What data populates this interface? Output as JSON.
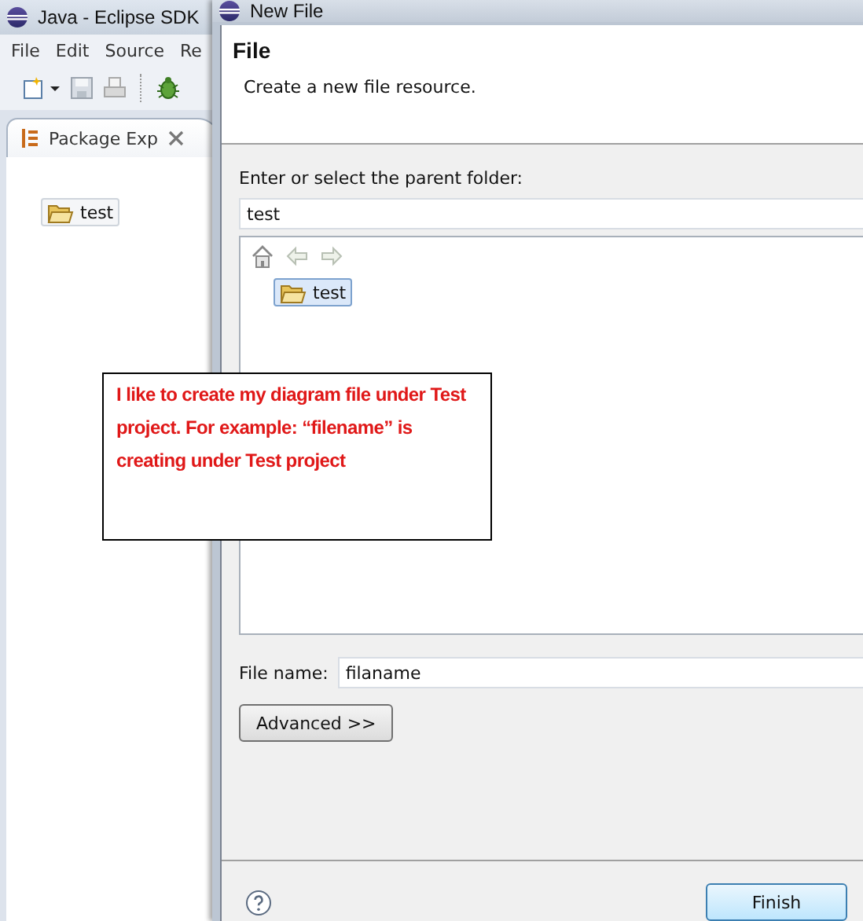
{
  "background_window": {
    "title": "Java - Eclipse SDK",
    "menu": [
      "File",
      "Edit",
      "Source",
      "Re"
    ],
    "view_tab": {
      "label": "Package Exp"
    },
    "tree": [
      {
        "label": "test",
        "selected": true
      }
    ]
  },
  "dialog": {
    "title": "New File",
    "heading": "File",
    "description": "Create a new file resource.",
    "folder_label": "Enter or select the parent folder:",
    "folder_value": "test",
    "folder_tree": [
      {
        "label": "test",
        "selected": true
      }
    ],
    "file_name_label": "File name:",
    "file_name_value": "filaname",
    "advanced_button": "Advanced >>",
    "finish_button": "Finish"
  },
  "callout": {
    "text": "I like to create my diagram file under Test project. For example: “filename” is creating under Test project"
  }
}
